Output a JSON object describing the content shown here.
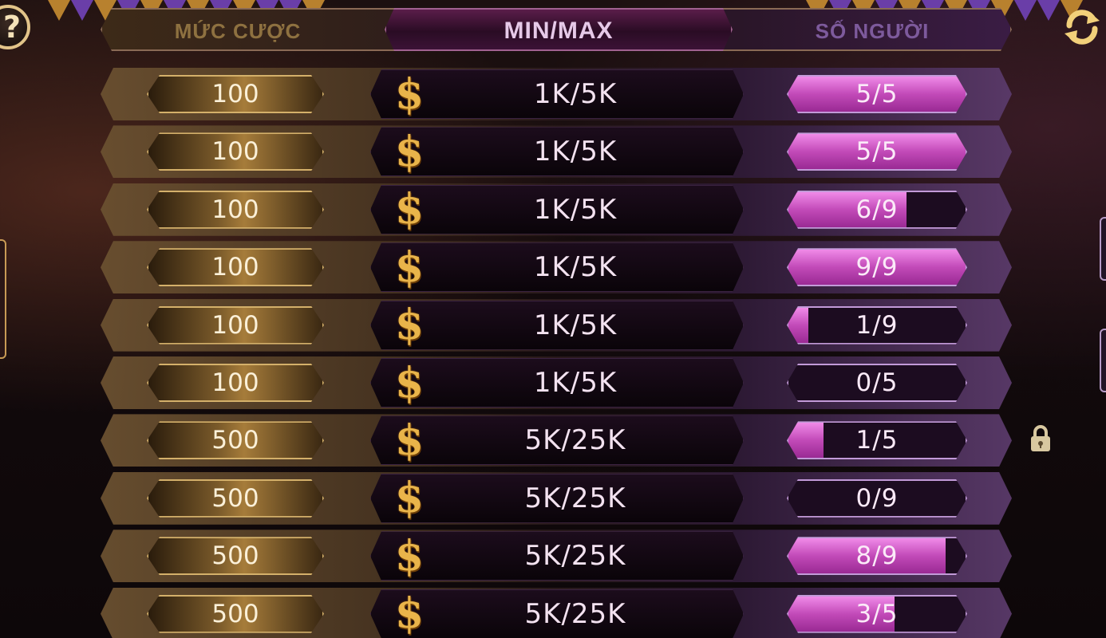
{
  "header": {
    "bet_label": "MỨC CƯỢC",
    "minmax_label": "MIN/MAX",
    "players_label": "SỐ NGƯỜI"
  },
  "icons": {
    "help": "question-mark-icon",
    "refresh": "refresh-icon",
    "currency": "dollar-icon",
    "lock": "lock-icon"
  },
  "currency_symbol": "$",
  "help_glyph": "?",
  "colors": {
    "gold": "#d4b06a",
    "purple_fill": "#c24ab8",
    "text_light": "#fbf0d8"
  },
  "tables": [
    {
      "bet": "100",
      "minmax": "1K/5K",
      "players": "5/5",
      "current": 5,
      "max": 5
    },
    {
      "bet": "100",
      "minmax": "1K/5K",
      "players": "5/5",
      "current": 5,
      "max": 5
    },
    {
      "bet": "100",
      "minmax": "1K/5K",
      "players": "6/9",
      "current": 6,
      "max": 9
    },
    {
      "bet": "100",
      "minmax": "1K/5K",
      "players": "9/9",
      "current": 9,
      "max": 9
    },
    {
      "bet": "100",
      "minmax": "1K/5K",
      "players": "1/9",
      "current": 1,
      "max": 9
    },
    {
      "bet": "100",
      "minmax": "1K/5K",
      "players": "0/5",
      "current": 0,
      "max": 5
    },
    {
      "bet": "500",
      "minmax": "5K/25K",
      "players": "1/5",
      "current": 1,
      "max": 5
    },
    {
      "bet": "500",
      "minmax": "5K/25K",
      "players": "0/9",
      "current": 0,
      "max": 9
    },
    {
      "bet": "500",
      "minmax": "5K/25K",
      "players": "8/9",
      "current": 8,
      "max": 9
    },
    {
      "bet": "500",
      "minmax": "5K/25K",
      "players": "3/5",
      "current": 3,
      "max": 5
    }
  ]
}
